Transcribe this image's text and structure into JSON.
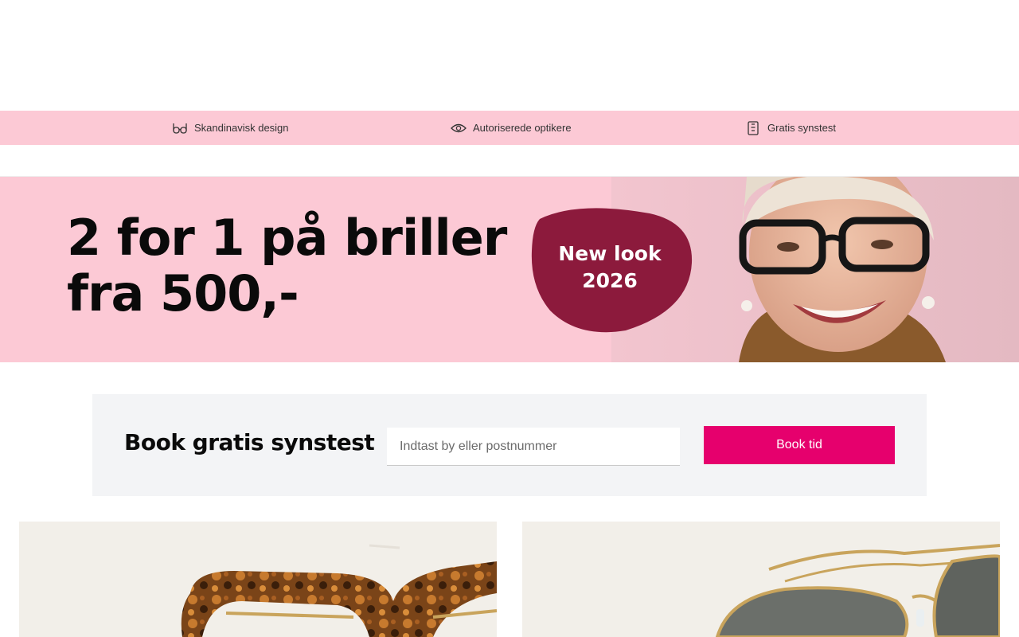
{
  "usps": [
    {
      "label": "Skandinavisk design",
      "icon": "glasses-icon"
    },
    {
      "label": "Autoriserede optikere",
      "icon": "eye-icon"
    },
    {
      "label": "Gratis synstest",
      "icon": "eye-chart-icon"
    }
  ],
  "hero": {
    "headline_line1": "2 for 1 på briller",
    "headline_line2": "fra 500,-",
    "badge_line1": "New look",
    "badge_line2": "2026",
    "badge_color": "#8c1a3c",
    "background_color": "#fcc9d5"
  },
  "booking": {
    "title": "Book gratis synstest",
    "input_placeholder": "Indtast by eller postnummer",
    "button_label": "Book tid",
    "button_color": "#e6006d"
  },
  "products": [
    {
      "icon": "tortoiseshell-glasses-image"
    },
    {
      "icon": "aviator-sunglasses-image"
    }
  ]
}
